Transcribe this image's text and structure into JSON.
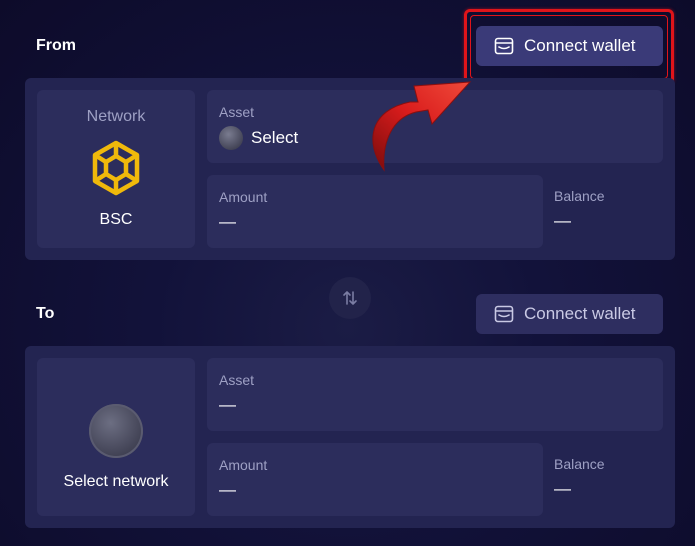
{
  "from": {
    "label": "From",
    "connect_wallet": "Connect wallet",
    "network": {
      "title": "Network",
      "name": "BSC",
      "icon": "bsc-icon"
    },
    "asset": {
      "label": "Asset",
      "value": "Select"
    },
    "amount": {
      "label": "Amount",
      "value": "—"
    },
    "balance": {
      "label": "Balance",
      "value": "—"
    }
  },
  "to": {
    "label": "To",
    "connect_wallet": "Connect wallet",
    "network": {
      "name": "Select network"
    },
    "asset": {
      "label": "Asset",
      "value": "—"
    },
    "amount": {
      "label": "Amount",
      "value": "—"
    },
    "balance": {
      "label": "Balance",
      "value": "—"
    }
  },
  "swap": {
    "icon": "swap-arrows-icon"
  },
  "colors": {
    "background": "#12123a",
    "panel": "#232451",
    "card": "#2c2d5c",
    "button": "#3a3a78",
    "highlight": "#e0141a",
    "bsc_yellow": "#f0b90b"
  }
}
